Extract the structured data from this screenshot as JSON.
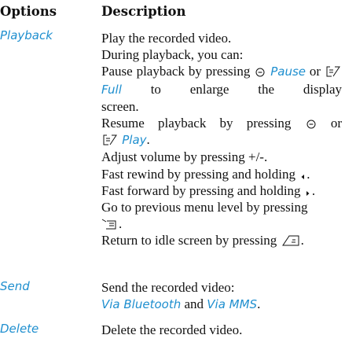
{
  "headers": {
    "options": "Options",
    "description": "Description"
  },
  "playback": {
    "option": "Playback",
    "line1": "Play the recorded video.",
    "line2": "During playback, you can:",
    "pause_a": "Pause playback by pressing",
    "pause_kw": "Pause",
    "pause_b": "or",
    "full_kw": "Full",
    "pause_c": "to enlarge the display",
    "pause_d": "screen.",
    "resume_a": "Resume playback by pressing",
    "resume_b": "or",
    "play_kw": "Play",
    "resume_end": ".",
    "volume": "Adjust volume by pressing +/-.",
    "rewind_a": "Fast rewind by pressing and holding",
    "rewind_end": ".",
    "forward_a": "Fast forward by pressing and holding",
    "forward_end": ".",
    "prev_a": "Go to previous menu level by pressing",
    "prev_end": ".",
    "idle_a": "Return to idle screen by pressing",
    "idle_end": "."
  },
  "send": {
    "option": "Send",
    "line1": "Send the recorded video:",
    "kw1": "Via Bluetooth",
    "and": "and",
    "kw2": "Via MMS",
    "end": "."
  },
  "delete": {
    "option": "Delete",
    "line1": "Delete the recorded video."
  },
  "icons": [
    "ok-key-icon",
    "left-softkey-icon",
    "left-key-icon",
    "right-key-icon",
    "clear-key-icon",
    "end-key-icon"
  ]
}
